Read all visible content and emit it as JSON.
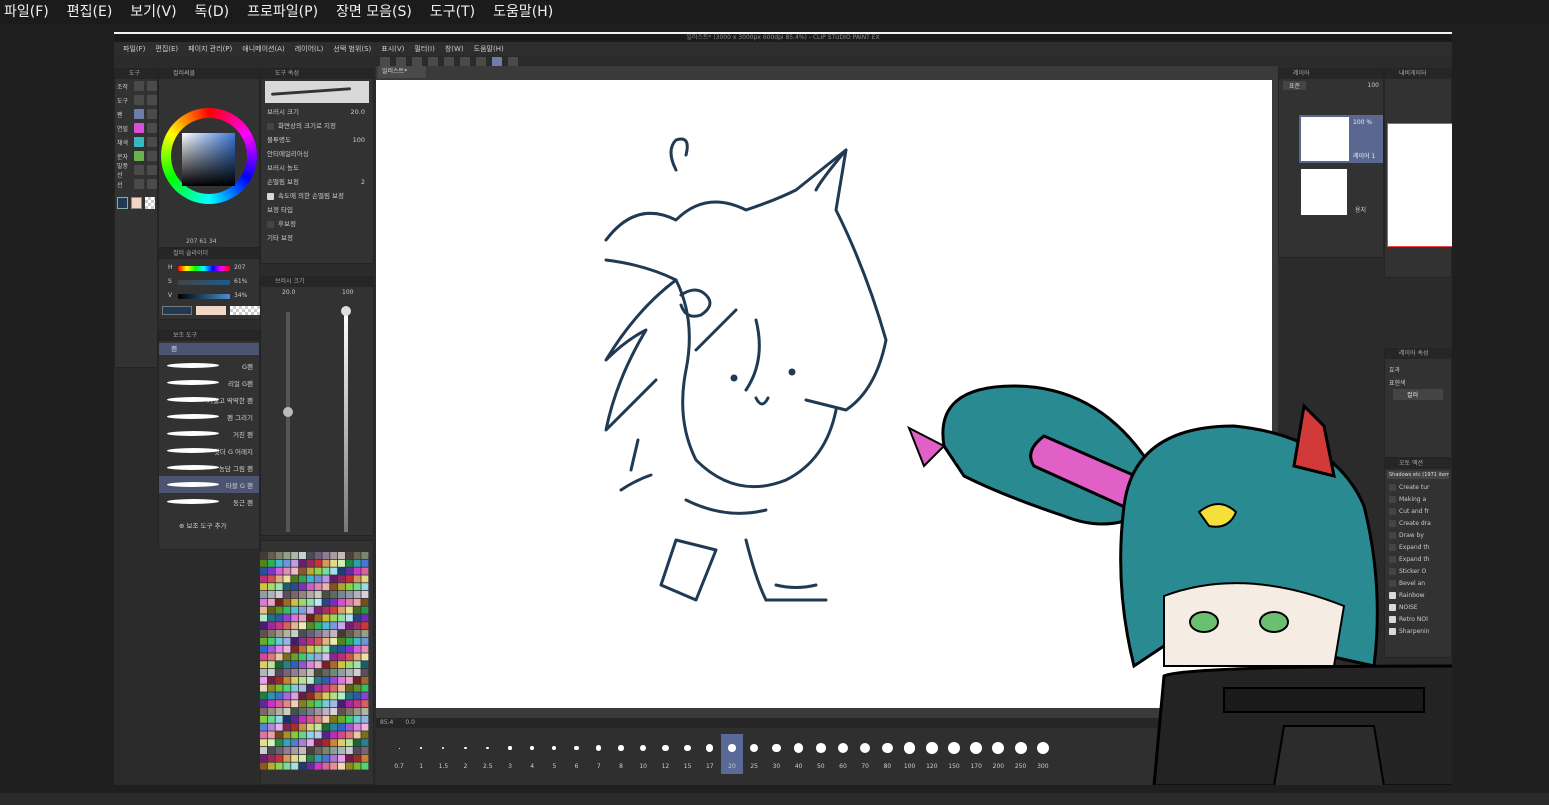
{
  "menubar": {
    "items": [
      "파일(F)",
      "편집(E)",
      "보기(V)",
      "독(D)",
      "프로파일(P)",
      "장면 모음(S)",
      "도구(T)",
      "도움말(H)"
    ]
  },
  "csp": {
    "title": "일러스트* (3000 x 3000px 600dpi 85.4%) - CLIP STUDIO PAINT EX",
    "menu": [
      "파일(F)",
      "편집(E)",
      "페이지 관리(P)",
      "애니메이션(A)",
      "레이어(L)",
      "선택 범위(S)",
      "표시(V)",
      "필터(I)",
      "창(W)",
      "도움말(H)"
    ],
    "tool_labels": [
      "조작",
      "도구",
      "펜",
      "연필",
      "채색",
      "문자",
      "말풍선",
      "선"
    ],
    "color_panel": {
      "tab": "컬러써클",
      "hsv_readout": "207 61 34"
    },
    "slider_panel": {
      "tab": "컬러 슬라이더",
      "rows": [
        {
          "label": "H",
          "value": "207"
        },
        {
          "label": "S",
          "value": "61%"
        },
        {
          "label": "V",
          "value": "34%"
        }
      ]
    },
    "tool_property": {
      "tab": "도구 속성",
      "rows": [
        "브러시 크기",
        "화면상의 크기로 지정",
        "불투명도",
        "안티에일리어싱",
        "브러시 농도",
        "손떨림 보정",
        "속도에 의한 손떨림 보정",
        "보정 타입",
        "후보정",
        "기타 보정"
      ],
      "brush_size": "20.0",
      "opacity": "100",
      "stabilization": "2"
    },
    "brush_size_panel": {
      "tab": "브러시 크기",
      "left_value": "20.0",
      "right_value": "100"
    },
    "sub_tool": {
      "tab": "보조 도구",
      "group": "펜",
      "brushes": [
        "G펜",
        "리얼 G펜",
        "거칠고 딱딱한 펜",
        "펜 그리기",
        "거친 펜",
        "찻더 G 어레지",
        "농담 그림 펜",
        "타블 G 펜",
        "둥근 펜"
      ],
      "add_label": "보조 도구 추가"
    },
    "canvas_tab": "일러스트*",
    "canvas_status": {
      "zoom": "85.4",
      "angle": "0.0"
    },
    "brush_sizes": [
      "0.7",
      "1",
      "1.5",
      "2",
      "2.5",
      "3",
      "4",
      "5",
      "6",
      "7",
      "8",
      "10",
      "12",
      "15",
      "17",
      "20",
      "25",
      "30",
      "40",
      "50",
      "60",
      "70",
      "80",
      "100",
      "120",
      "150",
      "170",
      "200",
      "250",
      "300"
    ],
    "selected_size": "20",
    "layer_panel": {
      "tab": "레이어",
      "blend": "표준",
      "opacity": "100",
      "layers": [
        {
          "opacity": "100 %",
          "name": "레이어 1"
        },
        {
          "opacity": "",
          "name": "용지"
        }
      ]
    },
    "navigator": {
      "tab": "내비게이터"
    },
    "layer_prop": {
      "tab": "레이어 속성",
      "label": "효과",
      "expression": "표현색",
      "color": "컬러"
    },
    "auto_actions": {
      "tab": "오토 액션",
      "set": "Shadows etc (1971 items)",
      "items": [
        "Create tur",
        "Making a",
        "Cut and fr",
        "Create dra",
        "Draw by",
        "Expand th",
        "Expand th",
        "Sticker O",
        "Bevel an",
        "Rainbow",
        "NOISE",
        "Retro NOI",
        "Sharpenin"
      ],
      "checked": [
        false,
        false,
        false,
        false,
        false,
        false,
        false,
        false,
        false,
        true,
        true,
        true,
        true
      ]
    }
  },
  "colors": {
    "main_color": "#1f3a52",
    "sub_color": "#f2d7c6",
    "accent": "#6d7ca8"
  }
}
